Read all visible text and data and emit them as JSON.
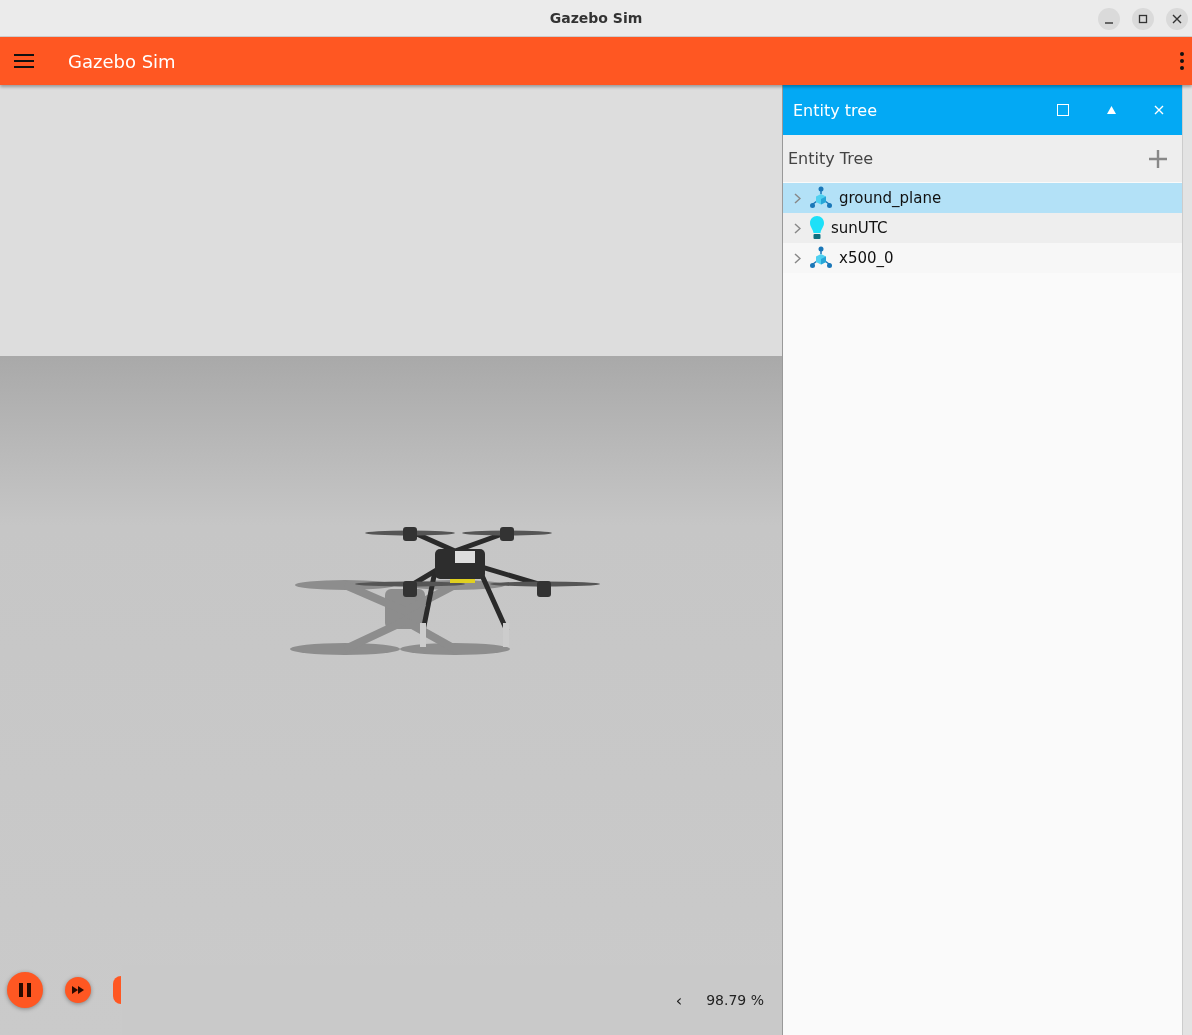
{
  "window": {
    "title": "Gazebo Sim"
  },
  "app_bar": {
    "title": "Gazebo Sim"
  },
  "entity_panel": {
    "title": "Entity tree",
    "subtitle": "Entity Tree",
    "items": [
      {
        "name": "ground_plane",
        "kind": "model",
        "selected": true,
        "expanded": false
      },
      {
        "name": "sunUTC",
        "kind": "light",
        "selected": false,
        "expanded": false
      },
      {
        "name": "x500_0",
        "kind": "model",
        "selected": false,
        "expanded": false
      }
    ]
  },
  "playback": {
    "paused": false
  },
  "status": {
    "collapse_glyph": "‹",
    "real_time_factor": "98.79 %"
  }
}
